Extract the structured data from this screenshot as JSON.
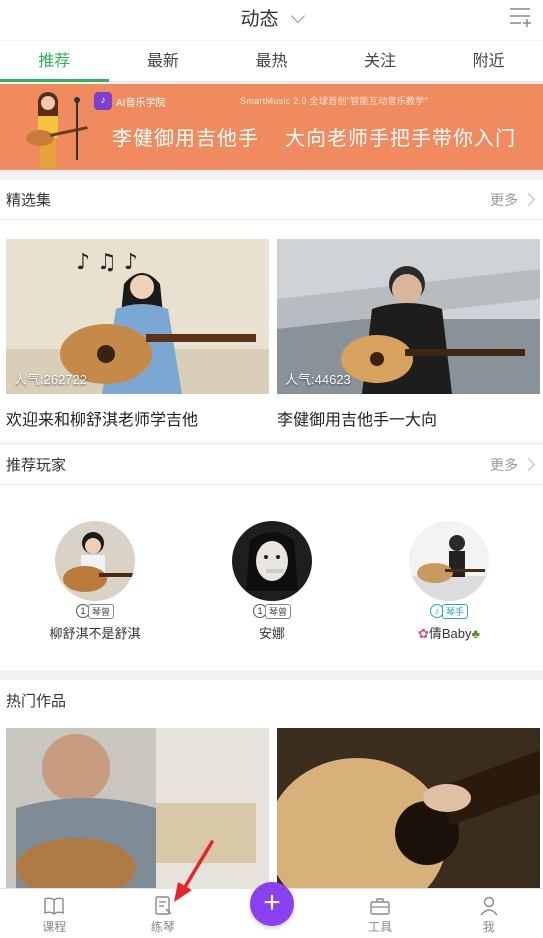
{
  "header": {
    "title": "动态"
  },
  "tabs": [
    {
      "label": "推荐",
      "active": true
    },
    {
      "label": "最新",
      "active": false
    },
    {
      "label": "最热",
      "active": false
    },
    {
      "label": "关注",
      "active": false
    },
    {
      "label": "附近",
      "active": false
    }
  ],
  "banner": {
    "logo_text": "AI音乐学院",
    "subline": "SmartMusic 2.0 全球首创\"智能互动音乐教学\"",
    "headline_left": "李健御用吉他手",
    "headline_right": "大向老师手把手带你入门"
  },
  "featured": {
    "title": "精选集",
    "more": "更多",
    "cards": [
      {
        "popularity": "人气:262722",
        "caption": "欢迎来和柳舒淇老师学吉他"
      },
      {
        "popularity": "人气:44623",
        "caption": "李健御用吉他手一大向"
      }
    ]
  },
  "players": {
    "title": "推荐玩家",
    "more": "更多",
    "items": [
      {
        "name": "柳舒淇不是舒淇",
        "level": "1",
        "badge": "琴曾"
      },
      {
        "name": "安娜",
        "level": "1",
        "badge": "琴曾"
      },
      {
        "name": "倩Baby",
        "level": "",
        "badge": "琴手"
      }
    ]
  },
  "hot": {
    "title": "热门作品"
  },
  "bottom_nav": {
    "items": [
      {
        "label": "课程",
        "icon": "book-icon"
      },
      {
        "label": "练琴",
        "icon": "practice-icon"
      },
      {
        "label": "",
        "icon": "plus-icon"
      },
      {
        "label": "工具",
        "icon": "toolbox-icon"
      },
      {
        "label": "我",
        "icon": "person-icon"
      }
    ],
    "plus_symbol": "+"
  },
  "colors": {
    "accent": "#2db55d",
    "plus": "#8a3ff0",
    "banner": "#f08b5f"
  }
}
